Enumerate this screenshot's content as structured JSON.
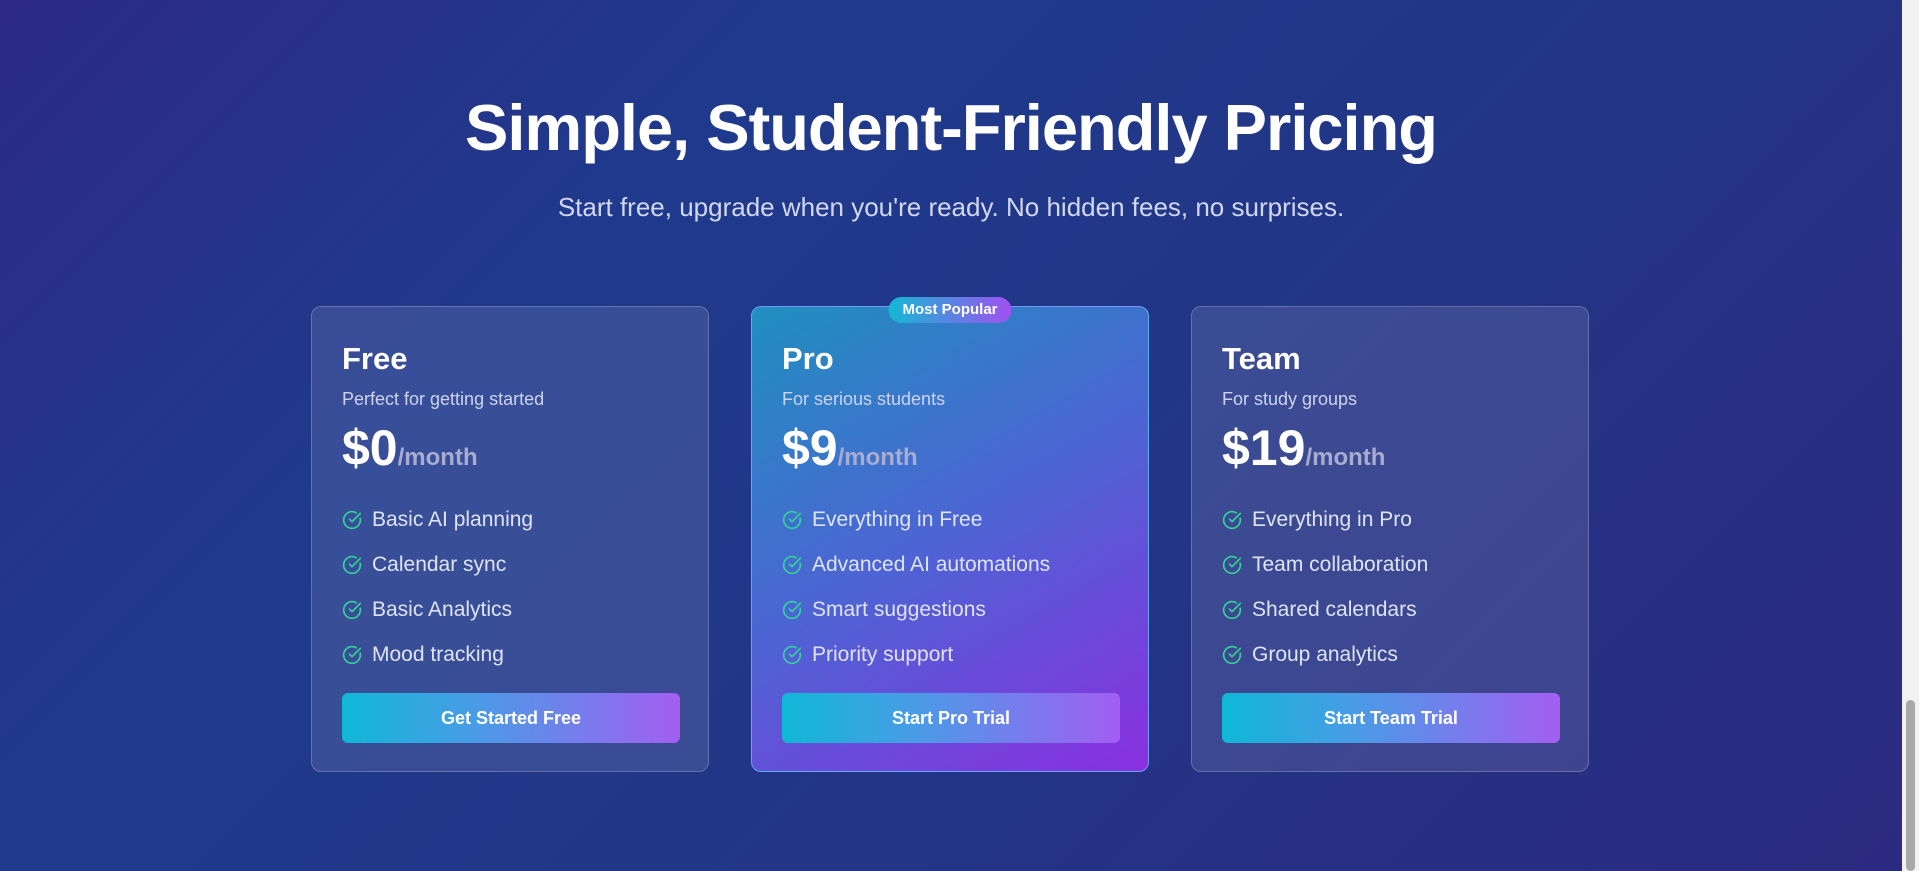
{
  "pricing": {
    "title": "Simple, Student-Friendly Pricing",
    "subtitle": "Start free, upgrade when you're ready. No hidden fees, no surprises.",
    "plans": [
      {
        "name": "Free",
        "description": "Perfect for getting started",
        "price": "$0",
        "period": "/month",
        "features": [
          "Basic AI planning",
          "Calendar sync",
          "Basic Analytics",
          "Mood tracking"
        ],
        "cta": "Get Started Free"
      },
      {
        "name": "Pro",
        "badge": "Most Popular",
        "description": "For serious students",
        "price": "$9",
        "period": "/month",
        "features": [
          "Everything in Free",
          "Advanced AI automations",
          "Smart suggestions",
          "Priority support"
        ],
        "cta": "Start Pro Trial"
      },
      {
        "name": "Team",
        "description": "For study groups",
        "price": "$19",
        "period": "/month",
        "features": [
          "Everything in Pro",
          "Team collaboration",
          "Shared calendars",
          "Group analytics"
        ],
        "cta": "Start Team Trial"
      }
    ]
  },
  "colors": {
    "check": "#34d399",
    "accent_start": "#10b8d6",
    "accent_end": "#a35ef2"
  },
  "icons": {
    "feature_icon": "check-circle-icon"
  }
}
